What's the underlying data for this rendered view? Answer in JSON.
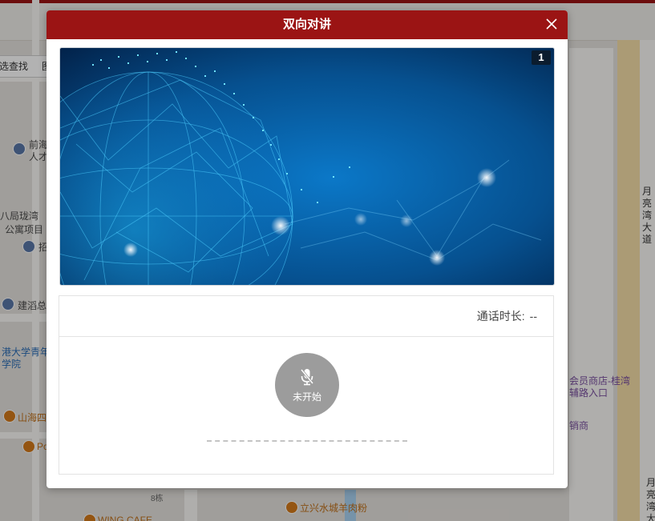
{
  "dialog": {
    "title": "双向对讲",
    "channel_number": "1",
    "duration_label": "通话时长:",
    "duration_value": "--",
    "mic_status": "未开始"
  },
  "colors": {
    "header": "#9b1414",
    "mic_button": "#9c9c9c"
  },
  "background_map": {
    "toolbar_text": "选查找",
    "toolbar_text2": "图",
    "labels": [
      "前海",
      "人才",
      "八局珑湾",
      "公寓项目",
      "招",
      "建滔总",
      "港大学青年",
      "学院",
      "山海四",
      "Po",
      "月亮湾大道",
      "会员商店-桂湾",
      "辅路入口",
      "销商",
      "月亮湾大",
      "8栋",
      "立兴水城羊肉粉",
      "WING CAFE"
    ]
  }
}
